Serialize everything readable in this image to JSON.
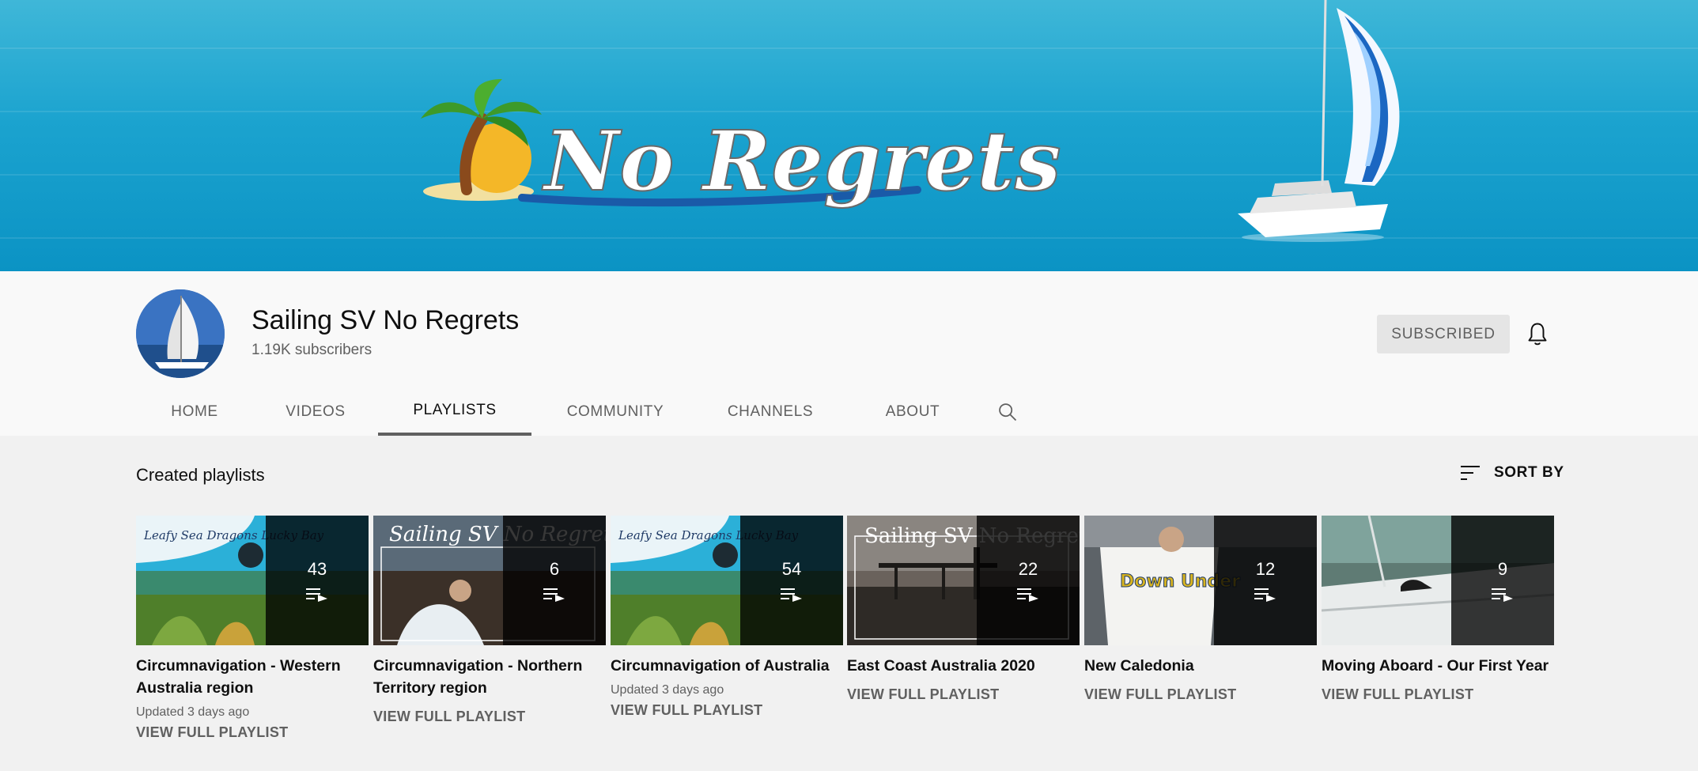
{
  "banner": {
    "logo_text": "No Regrets"
  },
  "channel": {
    "name": "Sailing SV No Regrets",
    "subscribers": "1.19K subscribers",
    "subscribe_label": "SUBSCRIBED",
    "bell_icon": "bell-icon"
  },
  "tabs": [
    {
      "label": "HOME"
    },
    {
      "label": "VIDEOS"
    },
    {
      "label": "PLAYLISTS",
      "active": true
    },
    {
      "label": "COMMUNITY"
    },
    {
      "label": "CHANNELS"
    },
    {
      "label": "ABOUT"
    }
  ],
  "section": {
    "title": "Created playlists",
    "sort_label": "SORT BY",
    "sort_icon": "sort-icon"
  },
  "playlists": [
    {
      "count": "43",
      "title": "Circumnavigation - Western Australia region",
      "updated": "Updated 3 days ago",
      "link": "VIEW FULL PLAYLIST",
      "thumb_text": "Leafy Sea Dragons Lucky Bay"
    },
    {
      "count": "6",
      "title": "Circumnavigation - Northern Territory region",
      "updated": "",
      "link": "VIEW FULL PLAYLIST",
      "thumb_text": "Sailing SV No Regrets"
    },
    {
      "count": "54",
      "title": "Circumnavigation of Australia",
      "updated": "Updated 3 days ago",
      "link": "VIEW FULL PLAYLIST",
      "thumb_text": "Leafy Sea Dragons Lucky Bay"
    },
    {
      "count": "22",
      "title": "East Coast Australia 2020",
      "updated": "",
      "link": "VIEW FULL PLAYLIST",
      "thumb_text": "Sailing SV No Regrets"
    },
    {
      "count": "12",
      "title": "New Caledonia",
      "updated": "",
      "link": "VIEW FULL PLAYLIST",
      "thumb_text": "Down Under"
    },
    {
      "count": "9",
      "title": "Moving Aboard - Our First Year",
      "updated": "",
      "link": "VIEW FULL PLAYLIST",
      "thumb_text": ""
    }
  ],
  "colors": {
    "banner_sea": "#1ba3cf",
    "header_bg": "#f9f9f9",
    "page_bg": "#f1f1f1",
    "subscribed_bg": "#e5e5e5",
    "text_secondary": "#606060"
  }
}
